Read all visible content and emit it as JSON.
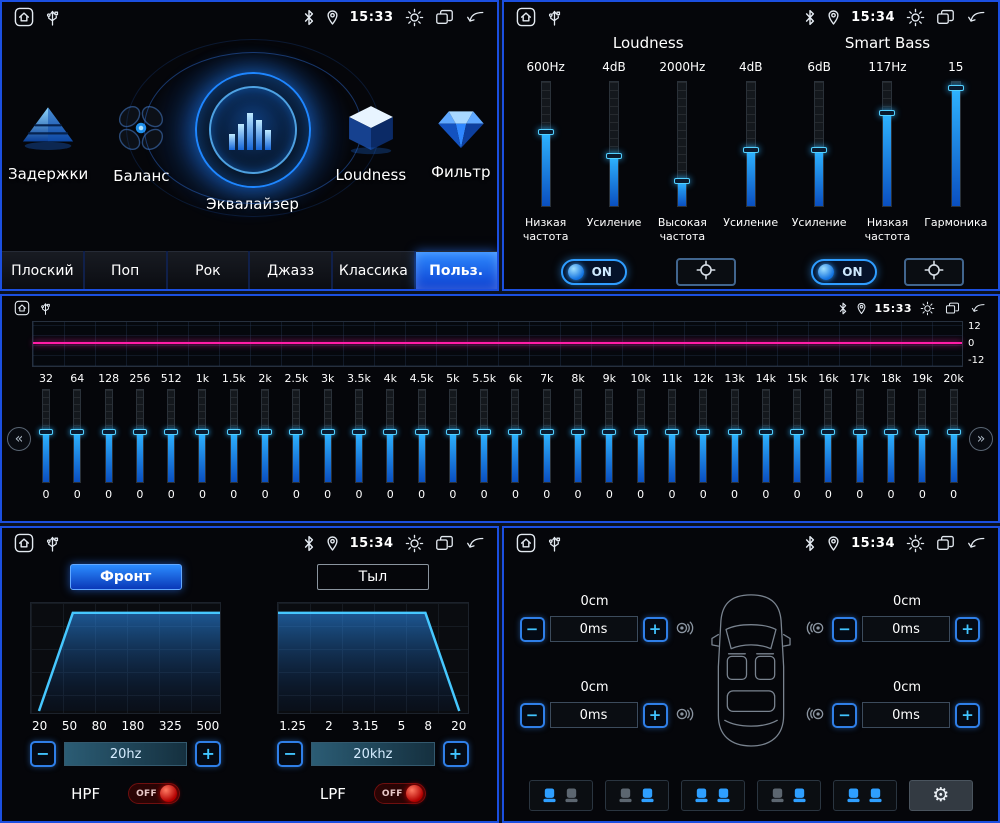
{
  "icons": {
    "gear": "⚙",
    "minus": "−",
    "plus": "+",
    "prev": "«",
    "next": "»"
  },
  "colors": {
    "panel_border": "#1b4fe0",
    "slider_fill": "#2fb4ff",
    "eq_line": "#ff1ca6",
    "off_red": "#d40000",
    "active_tab": "#2e8bff"
  },
  "status_bars": {
    "menu": {
      "time": "15:33"
    },
    "loudness": {
      "time": "15:34"
    },
    "equalizer": {
      "time": "15:33"
    },
    "filters": {
      "time": "15:34"
    },
    "delays": {
      "time": "15:34"
    }
  },
  "menu_panel": {
    "items": [
      {
        "label": "Задержки"
      },
      {
        "label": "Баланс"
      },
      {
        "label": "Эквалайзер",
        "active": true
      },
      {
        "label": "Loudness"
      },
      {
        "label": "Фильтр"
      }
    ],
    "presets": [
      {
        "label": "Плоский"
      },
      {
        "label": "Поп"
      },
      {
        "label": "Рок"
      },
      {
        "label": "Джазз"
      },
      {
        "label": "Классика"
      },
      {
        "label": "Польз.",
        "active": true
      }
    ]
  },
  "loudness_panel": {
    "sections": [
      {
        "title": "Loudness",
        "toggle": "ON",
        "sliders": [
          {
            "value": "600Hz",
            "label": "Низкая частота",
            "fill": 60
          },
          {
            "value": "4dB",
            "label": "Усиление",
            "fill": 40
          },
          {
            "value": "2000Hz",
            "label": "Высокая частота",
            "fill": 20
          },
          {
            "value": "4dB",
            "label": "Усиление",
            "fill": 45
          }
        ]
      },
      {
        "title": "Smart Bass",
        "toggle": "ON",
        "sliders": [
          {
            "value": "6dB",
            "label": "Усиление",
            "fill": 45
          },
          {
            "value": "117Hz",
            "label": "Низкая частота",
            "fill": 75
          },
          {
            "value": "15",
            "label": "Гармоника",
            "fill": 95
          }
        ]
      }
    ]
  },
  "eq_panel": {
    "scale": [
      "12",
      "0",
      "-12"
    ],
    "band_fill": 54,
    "freqs": [
      "32",
      "64",
      "128",
      "256",
      "512",
      "1k",
      "1.5k",
      "2k",
      "2.5k",
      "3k",
      "3.5k",
      "4k",
      "4.5k",
      "5k",
      "5.5k",
      "6k",
      "7k",
      "8k",
      "9k",
      "10k",
      "11k",
      "12k",
      "13k",
      "14k",
      "15k",
      "16k",
      "17k",
      "18k",
      "19k",
      "20k"
    ],
    "values": [
      "0",
      "0",
      "0",
      "0",
      "0",
      "0",
      "0",
      "0",
      "0",
      "0",
      "0",
      "0",
      "0",
      "0",
      "0",
      "0",
      "0",
      "0",
      "0",
      "0",
      "0",
      "0",
      "0",
      "0",
      "0",
      "0",
      "0",
      "0",
      "0",
      "0"
    ]
  },
  "filter_panel": {
    "tabs": [
      {
        "label": "Фронт",
        "active": true
      },
      {
        "label": "Тыл",
        "active": false
      }
    ],
    "hpf": {
      "label": "HPF",
      "state": "OFF",
      "value": "20hz",
      "axis": [
        "20",
        "50",
        "80",
        "180",
        "325",
        "500"
      ]
    },
    "lpf": {
      "label": "LPF",
      "state": "OFF",
      "value": "20khz",
      "axis": [
        "1.25",
        "2",
        "3.15",
        "5",
        "8",
        "20"
      ]
    }
  },
  "delay_panel": {
    "corners": [
      {
        "position": "front-left",
        "distance": "0cm",
        "delay": "0ms"
      },
      {
        "position": "front-right",
        "distance": "0cm",
        "delay": "0ms"
      },
      {
        "position": "rear-left",
        "distance": "0cm",
        "delay": "0ms"
      },
      {
        "position": "rear-right",
        "distance": "0cm",
        "delay": "0ms"
      }
    ],
    "seat_buttons": [
      {
        "name": "seat-driver",
        "pattern": [
          1,
          0
        ]
      },
      {
        "name": "seat-passenger",
        "pattern": [
          0,
          1
        ]
      },
      {
        "name": "seat-front",
        "pattern": [
          1,
          1
        ]
      },
      {
        "name": "seat-rear",
        "pattern": [
          0,
          1
        ]
      },
      {
        "name": "seat-all",
        "pattern": [
          1,
          1
        ]
      },
      {
        "name": "settings",
        "gear": true,
        "active": true
      }
    ]
  }
}
